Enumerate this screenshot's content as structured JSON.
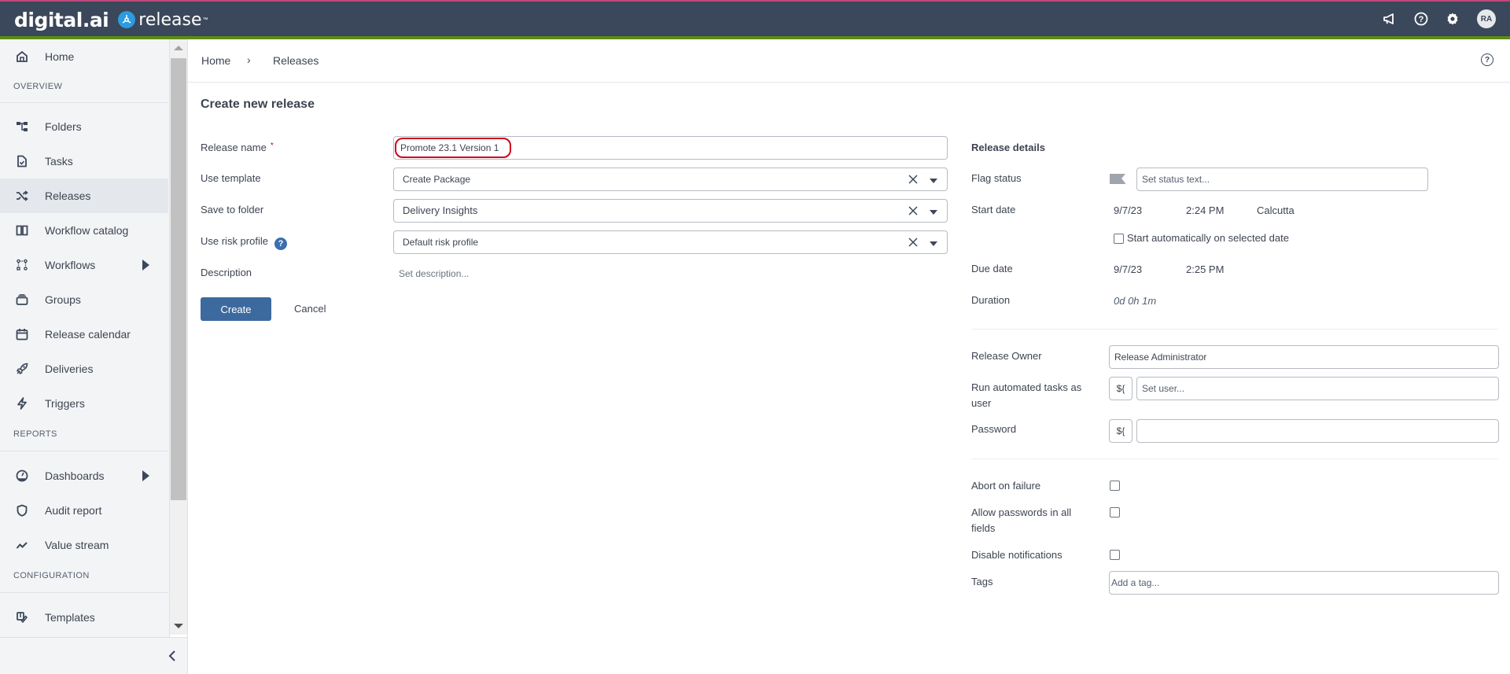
{
  "header": {
    "brand_digital": "digital.ai",
    "brand_product": "release",
    "icons": [
      "announcement-icon",
      "help-icon",
      "settings-gear-icon"
    ],
    "avatar_initials": "RA"
  },
  "sidebar": {
    "items": [
      {
        "label": "Home",
        "icon": "home-icon"
      },
      {
        "label": "Folders",
        "icon": "folders-tree-icon"
      },
      {
        "label": "Tasks",
        "icon": "tasks-icon"
      },
      {
        "label": "Releases",
        "icon": "shuffle-icon",
        "active": true
      },
      {
        "label": "Workflow catalog",
        "icon": "book-icon"
      },
      {
        "label": "Workflows",
        "icon": "workflow-icon",
        "has_submenu": true
      },
      {
        "label": "Groups",
        "icon": "groups-icon"
      },
      {
        "label": "Release calendar",
        "icon": "calendar-icon"
      },
      {
        "label": "Deliveries",
        "icon": "rocket-icon"
      },
      {
        "label": "Triggers",
        "icon": "lightning-icon"
      },
      {
        "label": "Dashboards",
        "icon": "dashboard-gauge-icon",
        "has_submenu": true
      },
      {
        "label": "Audit report",
        "icon": "shield-icon"
      },
      {
        "label": "Value stream",
        "icon": "trend-line-icon"
      },
      {
        "label": "Templates",
        "icon": "templates-icon"
      }
    ],
    "sections": {
      "overview": "OVERVIEW",
      "reports": "REPORTS",
      "configuration": "CONFIGURATION"
    }
  },
  "breadcrumb": {
    "items": [
      "Home",
      "Releases"
    ],
    "separator": "›"
  },
  "form": {
    "title": "Create new release",
    "release_name": {
      "label": "Release name",
      "required_mark": "*",
      "value": "Promote 23.1 Version 1"
    },
    "use_template": {
      "label": "Use template",
      "value": "Create Package"
    },
    "save_to_folder": {
      "label": "Save to folder",
      "value": "Delivery Insights"
    },
    "use_risk_profile": {
      "label": "Use risk profile",
      "help": "?",
      "value": "Default risk profile"
    },
    "description": {
      "label": "Description",
      "placeholder": "Set description..."
    },
    "create_label": "Create",
    "cancel_label": "Cancel"
  },
  "release_details": {
    "title": "Release details",
    "flag_status": {
      "label": "Flag status",
      "placeholder": "Set status text..."
    },
    "start_date": {
      "label": "Start date",
      "date": "9/7/23",
      "time": "2:24 PM",
      "timezone": "Calcutta"
    },
    "start_automatically": {
      "label": "Start automatically on selected date",
      "checked": false
    },
    "due_date": {
      "label": "Due date",
      "date": "9/7/23",
      "time": "2:25 PM"
    },
    "duration": {
      "label": "Duration",
      "value": "0d 0h 1m"
    },
    "release_owner": {
      "label": "Release Owner",
      "value": "Release Administrator"
    },
    "run_as_user": {
      "label": "Run automated tasks as user",
      "var_button": "${",
      "placeholder": "Set user..."
    },
    "password": {
      "label": "Password",
      "var_button": "${",
      "value": ""
    },
    "abort_on_failure": {
      "label": "Abort on failure",
      "checked": false
    },
    "allow_passwords": {
      "label": "Allow passwords in all fields",
      "checked": false
    },
    "disable_notifications": {
      "label": "Disable notifications",
      "checked": false
    },
    "tags": {
      "label": "Tags",
      "placeholder": "Add a tag..."
    }
  }
}
